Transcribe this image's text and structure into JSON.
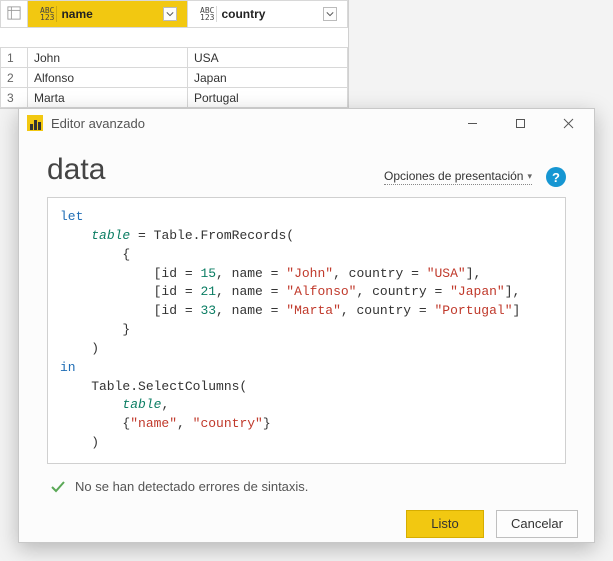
{
  "table": {
    "columns": [
      "name",
      "country"
    ],
    "selected_column_index": 0,
    "type_label_top": "ABC",
    "type_label_bottom": "123",
    "rows": [
      {
        "num": "1",
        "name": "John",
        "country": "USA"
      },
      {
        "num": "2",
        "name": "Alfonso",
        "country": "Japan"
      },
      {
        "num": "3",
        "name": "Marta",
        "country": "Portugal"
      }
    ]
  },
  "dialog": {
    "window_title": "Editor avanzado",
    "big_title": "data",
    "options_label": "Opciones de presentación",
    "status_text": "No se han detectado errores de sintaxis.",
    "buttons": {
      "ok": "Listo",
      "cancel": "Cancelar"
    },
    "code_tokens": [
      [
        "kw",
        "let"
      ],
      [
        "nl",
        ""
      ],
      [
        "ind",
        "1"
      ],
      [
        "id",
        "table"
      ],
      [
        "tx",
        " = Table.FromRecords("
      ],
      [
        "nl",
        ""
      ],
      [
        "ind",
        "2"
      ],
      [
        "tx",
        "{"
      ],
      [
        "nl",
        ""
      ],
      [
        "ind",
        "3"
      ],
      [
        "tx",
        "[id = "
      ],
      [
        "num",
        "15"
      ],
      [
        "tx",
        ", name = "
      ],
      [
        "str",
        "\"John\""
      ],
      [
        "tx",
        ", country = "
      ],
      [
        "str",
        "\"USA\""
      ],
      [
        "tx",
        "],"
      ],
      [
        "nl",
        ""
      ],
      [
        "ind",
        "3"
      ],
      [
        "tx",
        "[id = "
      ],
      [
        "num",
        "21"
      ],
      [
        "tx",
        ", name = "
      ],
      [
        "str",
        "\"Alfonso\""
      ],
      [
        "tx",
        ", country = "
      ],
      [
        "str",
        "\"Japan\""
      ],
      [
        "tx",
        "],"
      ],
      [
        "nl",
        ""
      ],
      [
        "ind",
        "3"
      ],
      [
        "tx",
        "[id = "
      ],
      [
        "num",
        "33"
      ],
      [
        "tx",
        ", name = "
      ],
      [
        "str",
        "\"Marta\""
      ],
      [
        "tx",
        ", country = "
      ],
      [
        "str",
        "\"Portugal\""
      ],
      [
        "tx",
        "]"
      ],
      [
        "nl",
        ""
      ],
      [
        "ind",
        "2"
      ],
      [
        "tx",
        "}"
      ],
      [
        "nl",
        ""
      ],
      [
        "ind",
        "1"
      ],
      [
        "tx",
        ")"
      ],
      [
        "nl",
        ""
      ],
      [
        "kw",
        "in"
      ],
      [
        "nl",
        ""
      ],
      [
        "ind",
        "1"
      ],
      [
        "tx",
        "Table.SelectColumns("
      ],
      [
        "nl",
        ""
      ],
      [
        "ind",
        "2"
      ],
      [
        "id",
        "table"
      ],
      [
        "tx",
        ","
      ],
      [
        "nl",
        ""
      ],
      [
        "ind",
        "2"
      ],
      [
        "tx",
        "{"
      ],
      [
        "str",
        "\"name\""
      ],
      [
        "tx",
        ", "
      ],
      [
        "str",
        "\"country\""
      ],
      [
        "tx",
        "}"
      ],
      [
        "nl",
        ""
      ],
      [
        "ind",
        "1"
      ],
      [
        "tx",
        ")"
      ]
    ]
  }
}
